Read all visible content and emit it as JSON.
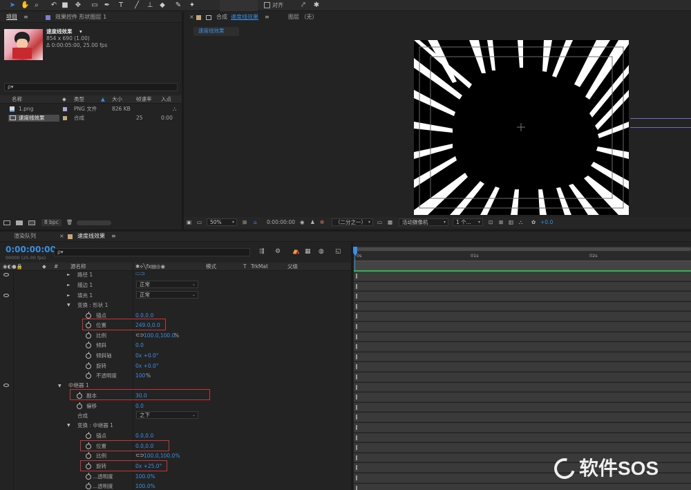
{
  "toolbar": {
    "align_label": "对齐",
    "icons": [
      "selection-arrow-icon",
      "hand-icon",
      "zoom-icon",
      "rotate-icon",
      "camera-icon",
      "pan-behind-icon",
      "rectangle-icon",
      "pen-icon",
      "text-icon",
      "brush-icon",
      "clone-icon",
      "eraser-icon",
      "roto-icon",
      "puppet-icon"
    ]
  },
  "project_panel": {
    "tab_project": "项目",
    "tab_effects": "效果控件 形状图层 1",
    "comp_name": "速度线效果",
    "comp_size": "854 x 690 (1.00)",
    "comp_duration": "Δ 0:00:05:00, 25.00 fps",
    "search_placeholder": "ρ▾",
    "columns": [
      "名称",
      "类型",
      "大小",
      "帧速率",
      "入点"
    ],
    "items": [
      {
        "name": "1.png",
        "type": "PNG 文件",
        "size": "826 KB",
        "fps": "",
        "in": ""
      },
      {
        "name": "速度线效果",
        "type": "合成",
        "size": "",
        "fps": "25",
        "in": "0:00"
      }
    ],
    "bpc": "8 bpc"
  },
  "comp_panel": {
    "tab_comp": "合成",
    "tab_comp_name": "速度线效果",
    "tab_layer": "图层 （无）",
    "sub_tab": "速度线效果",
    "zoom": "50%",
    "timecode": "0:00:00:00",
    "resolution": "（二分之一）",
    "camera": "活动摄像机",
    "views": "1 个...",
    "exposure": "+0.0"
  },
  "timeline": {
    "tab_render": "渲染队列",
    "tab_comp": "速度线效果",
    "timecode": "0:00:00:00",
    "frame_info": "00000 (25.00 fps)",
    "search_placeholder": "ρ▾",
    "col_hash": "#",
    "col_source": "源名称",
    "col_mode": "模式",
    "col_t": "T",
    "col_trkmat": "TrkMat",
    "col_parent": "父级",
    "ruler": [
      "0s",
      "01s",
      "02s"
    ],
    "rows": {
      "path": "路径 1",
      "stroke": "描边 1",
      "stroke_mode": "正常",
      "fill": "填充 1",
      "fill_mode": "正常",
      "transform_shape": "变换 : 形状 1",
      "anchor": "锚点",
      "anchor_val": "0.0,0.0",
      "position": "位置",
      "position_val": "249.0,0.0",
      "scale": "比例",
      "scale_val": "100.0,100.0",
      "scale_unit": "%",
      "skew": "倾斜",
      "skew_val": "0.0",
      "skew_axis": "倾斜轴",
      "skew_axis_val": "0x +0.0°",
      "rotation": "旋转",
      "rotation_val": "0x +0.0°",
      "opacity": "不透明度",
      "opacity_val": "100",
      "opacity_unit": "%",
      "repeater": "中继器 1",
      "copies": "副本",
      "copies_val": "30.0",
      "offset": "偏移",
      "offset_val": "0.0",
      "composite": "合成",
      "composite_val": "之下",
      "transform_repeater": "变换 : 中继器 1",
      "r_anchor": "锚点",
      "r_anchor_val": "0.0,0.0",
      "r_position": "位置",
      "r_position_val": "0.0,0.0",
      "r_scale": "比例",
      "r_scale_val": "100.0,100.0%",
      "r_rotation": "旋转",
      "r_rotation_val": "0x +25.0°",
      "r_start_opacity": "...透明度",
      "r_start_opacity_val": "100.0%",
      "r_end_opacity": "...透明度",
      "r_end_opacity_val": "100.0%"
    }
  },
  "watermark": "软件SOS",
  "colors": {
    "accent": "#3b8fe0",
    "highlight": "#c8353b",
    "bg": "#232323"
  }
}
